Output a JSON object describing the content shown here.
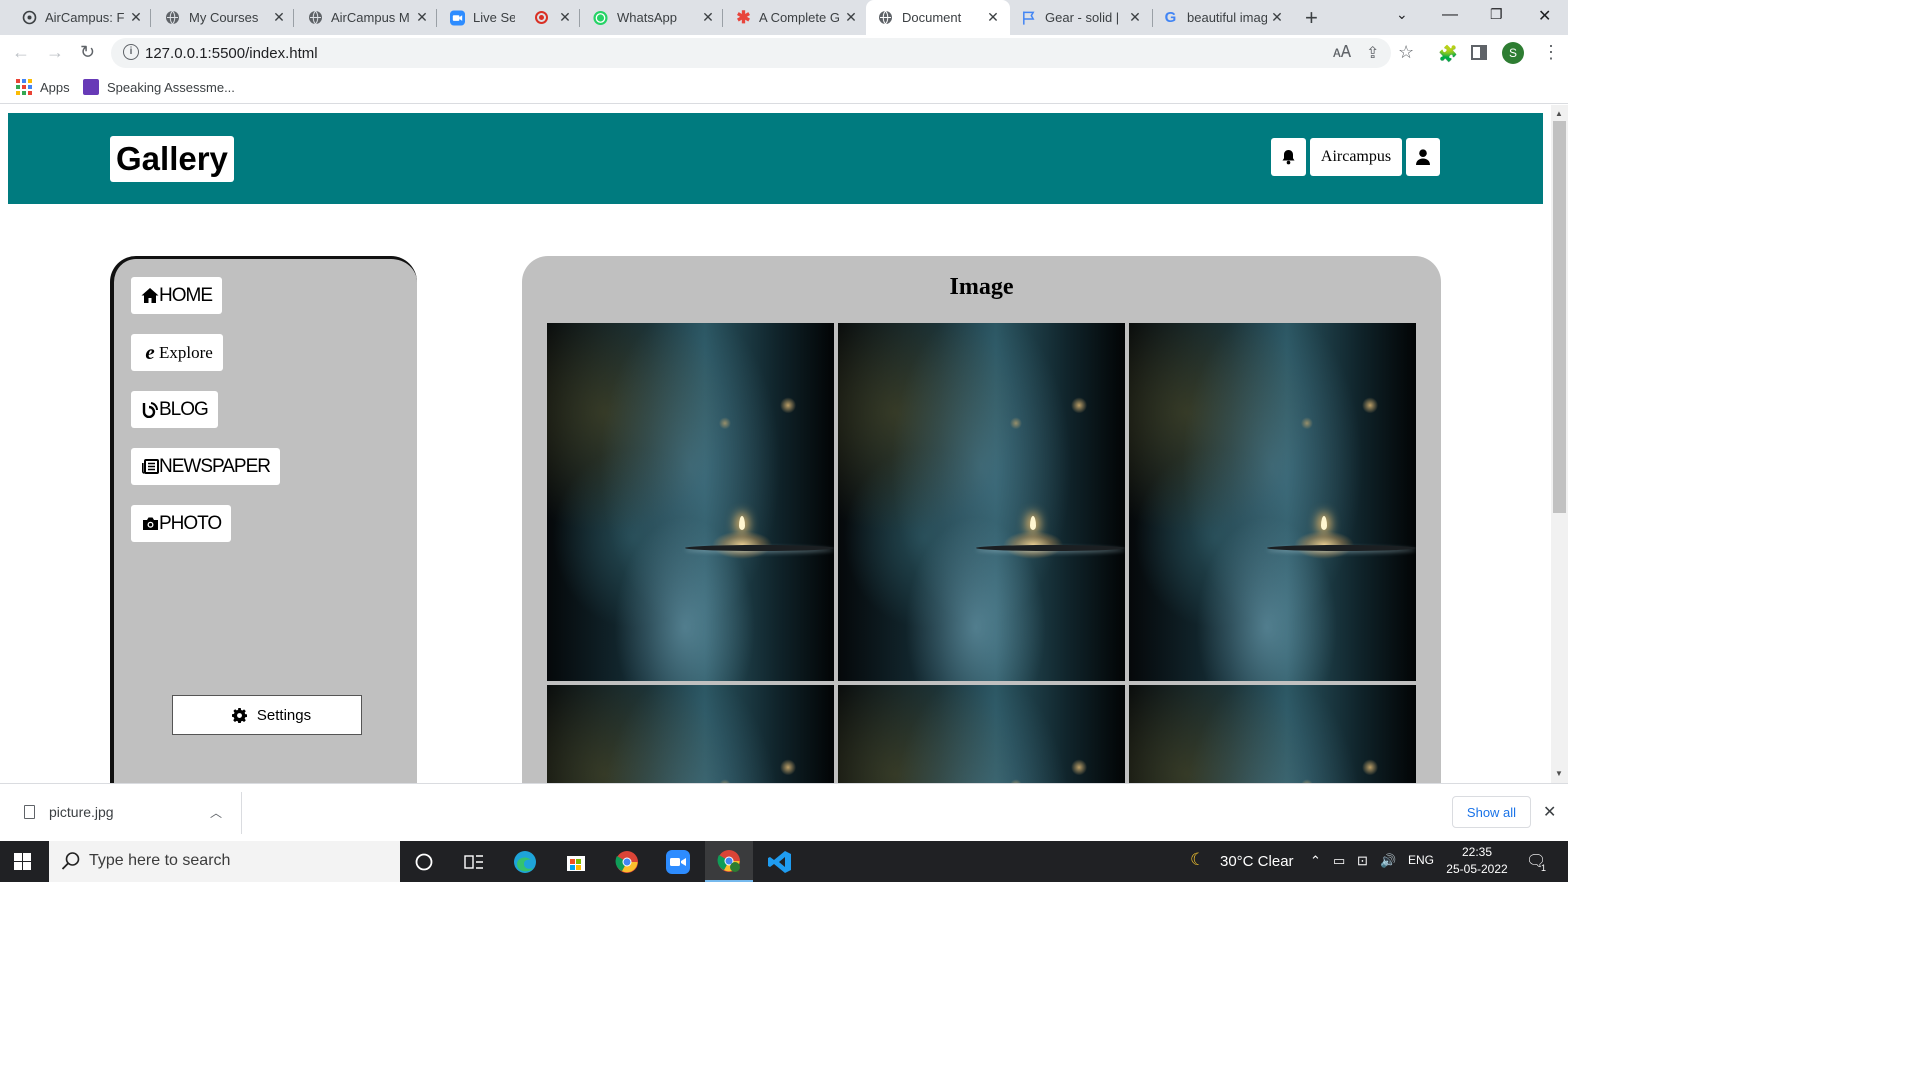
{
  "browser": {
    "tabs": [
      {
        "title": "AirCampus: Fu",
        "icon": "aircampus-icon"
      },
      {
        "title": "My Courses",
        "icon": "globe-icon"
      },
      {
        "title": "AirCampus M",
        "icon": "globe-icon"
      },
      {
        "title": "Live Sessi",
        "icon": "zoom-icon"
      },
      {
        "title": "WhatsApp",
        "icon": "whatsapp-icon"
      },
      {
        "title": "A Complete G",
        "icon": "asterisk-icon"
      },
      {
        "title": "Document",
        "icon": "globe-icon",
        "active": true
      },
      {
        "title": "Gear - solid |",
        "icon": "flag-icon"
      },
      {
        "title": "beautiful imag",
        "icon": "google-icon"
      }
    ],
    "url": "127.0.0.1:5500/index.html",
    "profile_initial": "S",
    "bookmarks": [
      {
        "label": "Apps"
      },
      {
        "label": "Speaking Assessme..."
      }
    ]
  },
  "page": {
    "header": {
      "logo": "Gallery",
      "account_label": "Aircampus",
      "accent_color": "#007b7f"
    },
    "sidebar": {
      "items": [
        {
          "label": "HOME",
          "icon": "home-icon"
        },
        {
          "label": "Explore",
          "icon": "internet-explorer-icon"
        },
        {
          "label": "BLOG",
          "icon": "blog-icon"
        },
        {
          "label": "NEWSPAPER",
          "icon": "newspaper-icon"
        },
        {
          "label": "PHOTO",
          "icon": "camera-icon"
        }
      ],
      "settings_label": "Settings"
    },
    "main": {
      "title": "Image"
    }
  },
  "downloads": {
    "file_name": "picture.jpg",
    "show_all": "Show all"
  },
  "taskbar": {
    "search_placeholder": "Type here to search",
    "weather": "30°C  Clear",
    "language": "ENG",
    "time": "22:35",
    "date": "25-05-2022",
    "notification_count": "1"
  }
}
